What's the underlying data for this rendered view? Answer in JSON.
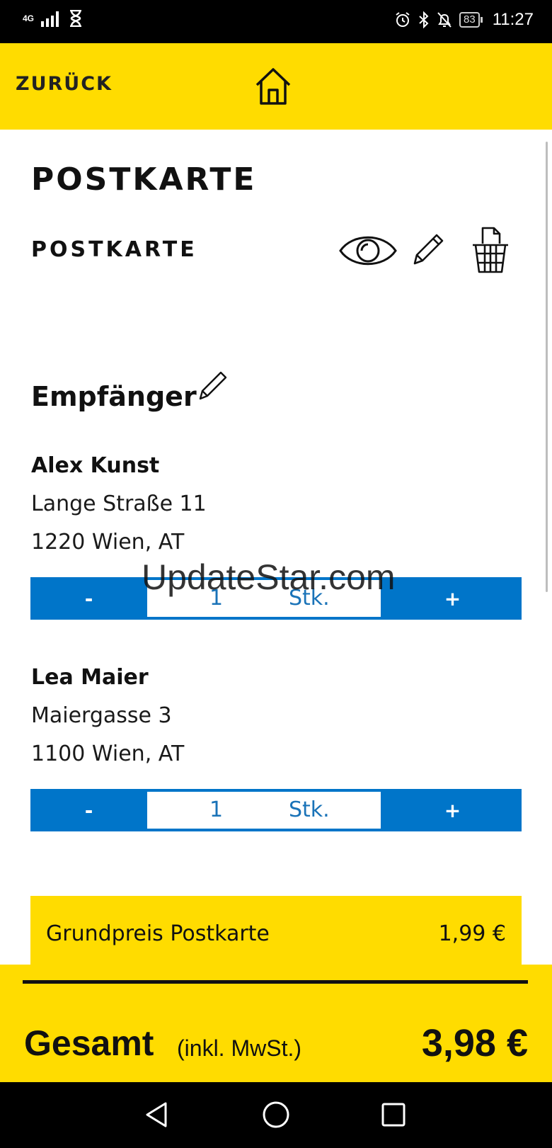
{
  "status_bar": {
    "network": "4G",
    "battery": "83",
    "time": "11:27"
  },
  "header": {
    "back_label": "ZURÜCK"
  },
  "product": {
    "title": "POSTKARTE",
    "subtitle": "POSTKARTE"
  },
  "recipients": {
    "section_title": "Empfänger",
    "items": [
      {
        "name": "Alex Kunst",
        "street": "Lange Straße 11",
        "city": "1220 Wien, AT",
        "quantity": "1",
        "unit": "Stk.",
        "minus_label": "-",
        "plus_label": "+"
      },
      {
        "name": "Lea Maier",
        "street": "Maiergasse 3",
        "city": "1100 Wien, AT",
        "quantity": "1",
        "unit": "Stk.",
        "minus_label": "-",
        "plus_label": "+"
      }
    ]
  },
  "pricing": {
    "base_label": "Grundpreis Postkarte",
    "base_value": "1,99 €",
    "total_label": "Gesamt",
    "total_note": "(inkl. MwSt.)",
    "total_value": "3,98 €"
  },
  "watermark": "UpdateStar.com",
  "colors": {
    "brand_yellow": "#ffdc00",
    "stepper_blue": "#0075c9"
  }
}
